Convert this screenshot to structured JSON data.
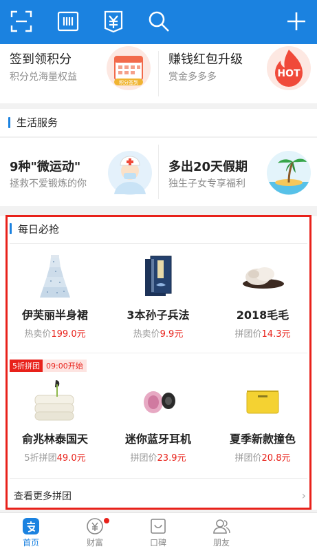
{
  "colors": {
    "primary": "#1b82e0",
    "accent_red": "#e8211a",
    "muted_text": "#8a8a8a"
  },
  "topbar": {
    "icons": [
      "scan-icon",
      "barcode-icon",
      "yen-card-icon",
      "search-icon",
      "plus-icon"
    ]
  },
  "promo_row_1": {
    "left": {
      "title": "签到领积分",
      "subtitle": "积分兑海量权益",
      "illustration_label": "积分签到"
    },
    "right": {
      "title": "赚钱红包升级",
      "subtitle": "赏金多多多",
      "illustration_label": "HOT"
    }
  },
  "life_services": {
    "title": "生活服务"
  },
  "promo_row_2": {
    "left": {
      "title": "9种\"微运动\"",
      "subtitle": "拯救不爱锻炼的你",
      "icon": "nurse-icon"
    },
    "right": {
      "title": "多出20天假期",
      "subtitle": "独生子女专享福利",
      "icon": "palm-island-icon"
    }
  },
  "daily_deals": {
    "title": "每日必抢",
    "items_row1": [
      {
        "name": "伊芙丽半身裙",
        "price_label": "热卖价",
        "price": "199.0元",
        "icon": "skirt-icon"
      },
      {
        "name": "3本孙子兵法",
        "price_label": "热卖价",
        "price": "9.9元",
        "icon": "book-set-icon"
      },
      {
        "name": "2018毛毛",
        "price_label": "拼团价",
        "price": "14.3元",
        "icon": "fur-slipper-icon"
      }
    ],
    "badge": {
      "discount": "5折拼团",
      "time": "09:00开始"
    },
    "items_row2": [
      {
        "name": "俞兆林泰国天",
        "price_label": "5折拼团",
        "price": "49.0元",
        "icon": "pillow-icon"
      },
      {
        "name": "迷你蓝牙耳机",
        "price_label": "拼团价",
        "price": "23.9元",
        "icon": "earphone-icon"
      },
      {
        "name": "夏季新款撞色",
        "price_label": "拼团价",
        "price": "20.8元",
        "icon": "handbag-icon"
      }
    ],
    "more_label": "查看更多拼团"
  },
  "tabbar": {
    "tabs": [
      {
        "label": "首页",
        "icon": "alipay-home-icon",
        "active": true
      },
      {
        "label": "财富",
        "icon": "wealth-icon",
        "active": false,
        "has_dot": true
      },
      {
        "label": "口碑",
        "icon": "koubei-icon",
        "active": false
      },
      {
        "label": "朋友",
        "icon": "friends-icon",
        "active": false
      }
    ]
  }
}
